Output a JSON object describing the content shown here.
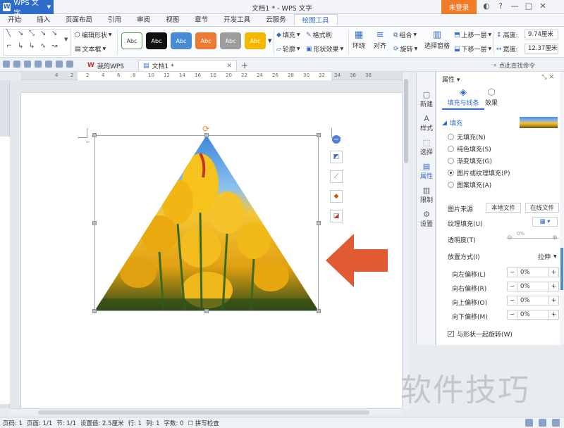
{
  "app": {
    "name": "WPS 文字",
    "window_title": "文档1 * - WPS 文字",
    "login": "未登录"
  },
  "menu_tabs": [
    "开始",
    "插入",
    "页面布局",
    "引用",
    "审阅",
    "视图",
    "章节",
    "开发工具",
    "云服务",
    "绘图工具"
  ],
  "active_menu_tab": "绘图工具",
  "ribbon": {
    "edit_shape": "编辑形状",
    "text_box": "文本框",
    "style_label": "Abc",
    "style_colors": [
      "#ffffff",
      "#111111",
      "#4a8bd6",
      "#ee7b35",
      "#9d9d9d",
      "#f5b800"
    ],
    "fill": "填充",
    "format_brush": "格式刷",
    "outline": "轮廓",
    "shape_effect": "形状效果",
    "wrap": "环绕",
    "align": "对齐",
    "group": "组合",
    "rotate": "旋转",
    "select_pane": "选择窗格",
    "bring_forward": "上移一层",
    "send_backward": "下移一层",
    "height_label": "高度:",
    "height_value": "9.74厘米",
    "width_label": "宽度:",
    "width_value": "12.37厘米"
  },
  "doc_tabs": {
    "home": "我的WPS",
    "doc": "文档1 *"
  },
  "search": "点此查找命令",
  "ruler_numbers": [
    "4",
    "2",
    "2",
    "4",
    "6",
    "8",
    "10",
    "12",
    "14",
    "16",
    "18",
    "20",
    "22",
    "24",
    "26",
    "28",
    "30",
    "32",
    "34",
    "36",
    "38"
  ],
  "side_tabs": [
    "新建",
    "样式",
    "选择",
    "属性",
    "限制",
    "设置"
  ],
  "active_side_tab": "属性",
  "panel": {
    "title": "属性",
    "tab_fill_line": "填充与线条",
    "tab_effect": "效果",
    "fill_section": "填充",
    "fill_options": [
      "无填充(N)",
      "纯色填充(S)",
      "渐变填充(G)",
      "图片或纹理填充(P)",
      "图案填充(A)"
    ],
    "fill_selected": "图片或纹理填充(P)",
    "image_source": "图片来源",
    "local_file": "本地文件",
    "online_file": "在线文件",
    "texture_fill": "纹理填充(U)",
    "transparency": "透明度(T)",
    "transparency_value": "0%",
    "placement": "放置方式(I)",
    "placement_value": "拉伸",
    "offsets": [
      {
        "label": "向左偏移(L)",
        "value": "0%"
      },
      {
        "label": "向右偏移(R)",
        "value": "0%"
      },
      {
        "label": "向上偏移(O)",
        "value": "0%"
      },
      {
        "label": "向下偏移(M)",
        "value": "0%"
      }
    ],
    "rotate_with_shape": "与形状一起旋转(W)"
  },
  "watermark": "软件技巧",
  "status": {
    "page_num": "页码: 1",
    "pages": "页面: 1/1",
    "section": "节: 1/1",
    "setting": "设置值: 2.5厘米",
    "row": "行: 1",
    "col": "列: 1",
    "words": "字数: 0",
    "spell": "拼写检查"
  }
}
